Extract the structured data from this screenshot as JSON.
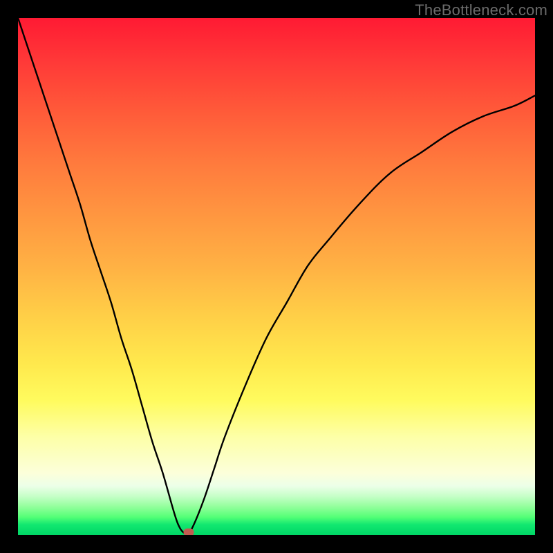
{
  "watermark": "TheBottleneck.com",
  "colors": {
    "frame": "#000000",
    "gradient_top": "#ff1a33",
    "gradient_mid": "#ffe94d",
    "gradient_bottom": "#00d666",
    "curve": "#000000",
    "marker": "#c15c51",
    "watermark_text": "#6c6c6c"
  },
  "chart_data": {
    "type": "line",
    "title": "",
    "xlabel": "",
    "ylabel": "",
    "xlim": [
      0,
      100
    ],
    "ylim": [
      0,
      100
    ],
    "series": [
      {
        "name": "bottleneck-curve",
        "x": [
          0,
          2,
          4,
          6,
          8,
          10,
          12,
          14,
          16,
          18,
          20,
          22,
          24,
          26,
          28,
          30,
          31,
          32,
          33,
          34,
          36,
          38,
          40,
          44,
          48,
          52,
          56,
          60,
          66,
          72,
          78,
          84,
          90,
          96,
          100
        ],
        "y": [
          100,
          94,
          88,
          82,
          76,
          70,
          64,
          57,
          51,
          45,
          38,
          32,
          25,
          18,
          12,
          5,
          2,
          0.5,
          0.5,
          2,
          7,
          13,
          19,
          29,
          38,
          45,
          52,
          57,
          64,
          70,
          74,
          78,
          81,
          83,
          85
        ]
      }
    ],
    "marker": {
      "x": 33,
      "y": 0.5
    },
    "annotations": []
  }
}
